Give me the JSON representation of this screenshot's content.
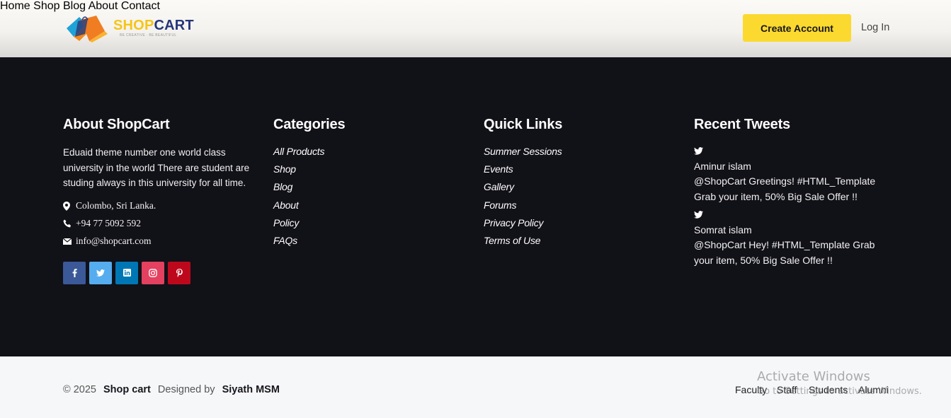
{
  "header": {
    "logo": {
      "shop": "SHOP",
      "cart": "CART",
      "tagline": "BE CREATIVE · BE BEAUTIFUL"
    },
    "nav": [
      "Home",
      "Shop",
      "Blog",
      "About",
      "Contact"
    ],
    "create_account": "Create Account",
    "login": "Log In"
  },
  "about": {
    "title": "About ShopCart",
    "text": "Eduaid theme number one world class university in the world There are student are studing always in this university for all time.",
    "location": "Colombo, Sri Lanka.",
    "phone": "+94 77 5092 592",
    "email": "info@shopcart.com",
    "socials": [
      {
        "icon": "facebook-icon",
        "glyph": "f",
        "color": "#3b5998"
      },
      {
        "icon": "twitter-icon",
        "glyph": "t",
        "color": "#55acee"
      },
      {
        "icon": "linkedin-icon",
        "glyph": "in",
        "color": "#0077b5"
      },
      {
        "icon": "instagram-icon",
        "glyph": "ig",
        "color": "#e4405f"
      },
      {
        "icon": "pinterest-icon",
        "glyph": "p",
        "color": "#bd081c"
      }
    ]
  },
  "categories": {
    "title": "Categories",
    "items": [
      "All Products",
      "Shop",
      "Blog",
      "About",
      "Policy",
      "FAQs"
    ]
  },
  "quick_links": {
    "title": "Quick Links",
    "items": [
      "Summer Sessions",
      "Events",
      "Gallery",
      "Forums",
      "Privacy Policy",
      "Terms of Use"
    ]
  },
  "tweets": {
    "title": "Recent Tweets",
    "items": [
      {
        "name": "Aminur islam",
        "text": "@ShopCart Greetings! #HTML_Template Grab your item, 50% Big Sale Offer !!"
      },
      {
        "name": "Somrat islam",
        "text": "@ShopCart Hey! #HTML_Template Grab your item, 50% Big Sale Offer !!"
      }
    ]
  },
  "bottom": {
    "copyright": "© 2025",
    "brand": "Shop cart",
    "designed_by": "Designed by",
    "designer": "Siyath MSM",
    "links": [
      "Faculty",
      "Staff",
      "Students",
      "Alumni"
    ]
  },
  "watermark": {
    "line1": "Activate Windows",
    "line2": "Go to Settings to activate Windows."
  }
}
